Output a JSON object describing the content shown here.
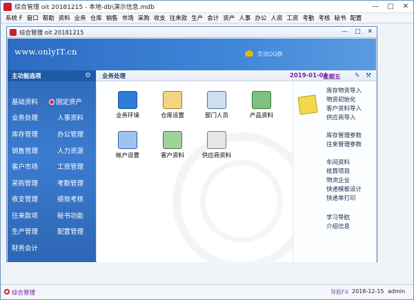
{
  "window": {
    "title": "综合管理 oit 20181215 - 本地-db\\演示信息.mdb",
    "buttons": [
      "—",
      "□",
      "✕"
    ]
  },
  "menu": [
    "系统 F",
    "窗口",
    "帮助",
    "资料",
    "业务",
    "仓库",
    "销售",
    "市场",
    "采购",
    "收支",
    "往来款",
    "生产",
    "会计",
    "资产",
    "人事",
    "办公",
    "人资",
    "工资",
    "考勤",
    "考核",
    "秘书",
    "配置"
  ],
  "inner_window": {
    "title": "综合管理 oit 20181215",
    "buttons": [
      "—",
      "□",
      "✕"
    ]
  },
  "banner": {
    "site": "www.onlyIT.cn",
    "qq_label": "交流QQ群"
  },
  "sidebar": {
    "header": "主功能选项",
    "items_col1": [
      "基础资料",
      "业务处理",
      "库存管理",
      "销售管理",
      "客户市场",
      "采购管理",
      "收支管理",
      "往来款项",
      "生产管理",
      "财务会计"
    ],
    "items_col2": [
      "固定资产",
      "人事资料",
      "办公管理",
      "人力资源",
      "工资管理",
      "考勤管理",
      "绩效考核",
      "秘书功能",
      "配置管理"
    ]
  },
  "content": {
    "section": "业务处理",
    "date": "2019-01-04",
    "weekday": "星期五",
    "tiles": [
      {
        "label": "业务环境",
        "icon": "blue-clock-icon",
        "color": "#2f7bd8"
      },
      {
        "label": "仓库设置",
        "icon": "magnifier-icon",
        "color": "#d9a628"
      },
      {
        "label": "部门人员",
        "icon": "magnifier-people-icon",
        "color": "#5a8ac0"
      },
      {
        "label": "产品资料",
        "icon": "table-icon",
        "color": "#3aa04a"
      },
      {
        "label": "帐户设置",
        "icon": "account-icon",
        "color": "#3a7fd0"
      },
      {
        "label": "客户资料",
        "icon": "customer-icon",
        "color": "#4c9a48"
      },
      {
        "label": "供应商资料",
        "icon": "supplier-icon",
        "color": "#8a8a8a"
      }
    ],
    "quick_links_1": [
      "库存物资导入",
      "物资初始化",
      "客户资料导入",
      "供应商导入"
    ],
    "quick_links_2": [
      "库存管理参数",
      "往来管理参数"
    ],
    "quick_links_3": [
      "车间资料",
      "核算项目",
      "物流企业",
      "快递模板设计",
      "快递单打印"
    ],
    "quick_links_4": [
      "学习导航",
      "介绍信息"
    ]
  },
  "status": {
    "module": "综合管理",
    "hint": "导航F4",
    "date": "2018-12-15",
    "user": "admin"
  }
}
